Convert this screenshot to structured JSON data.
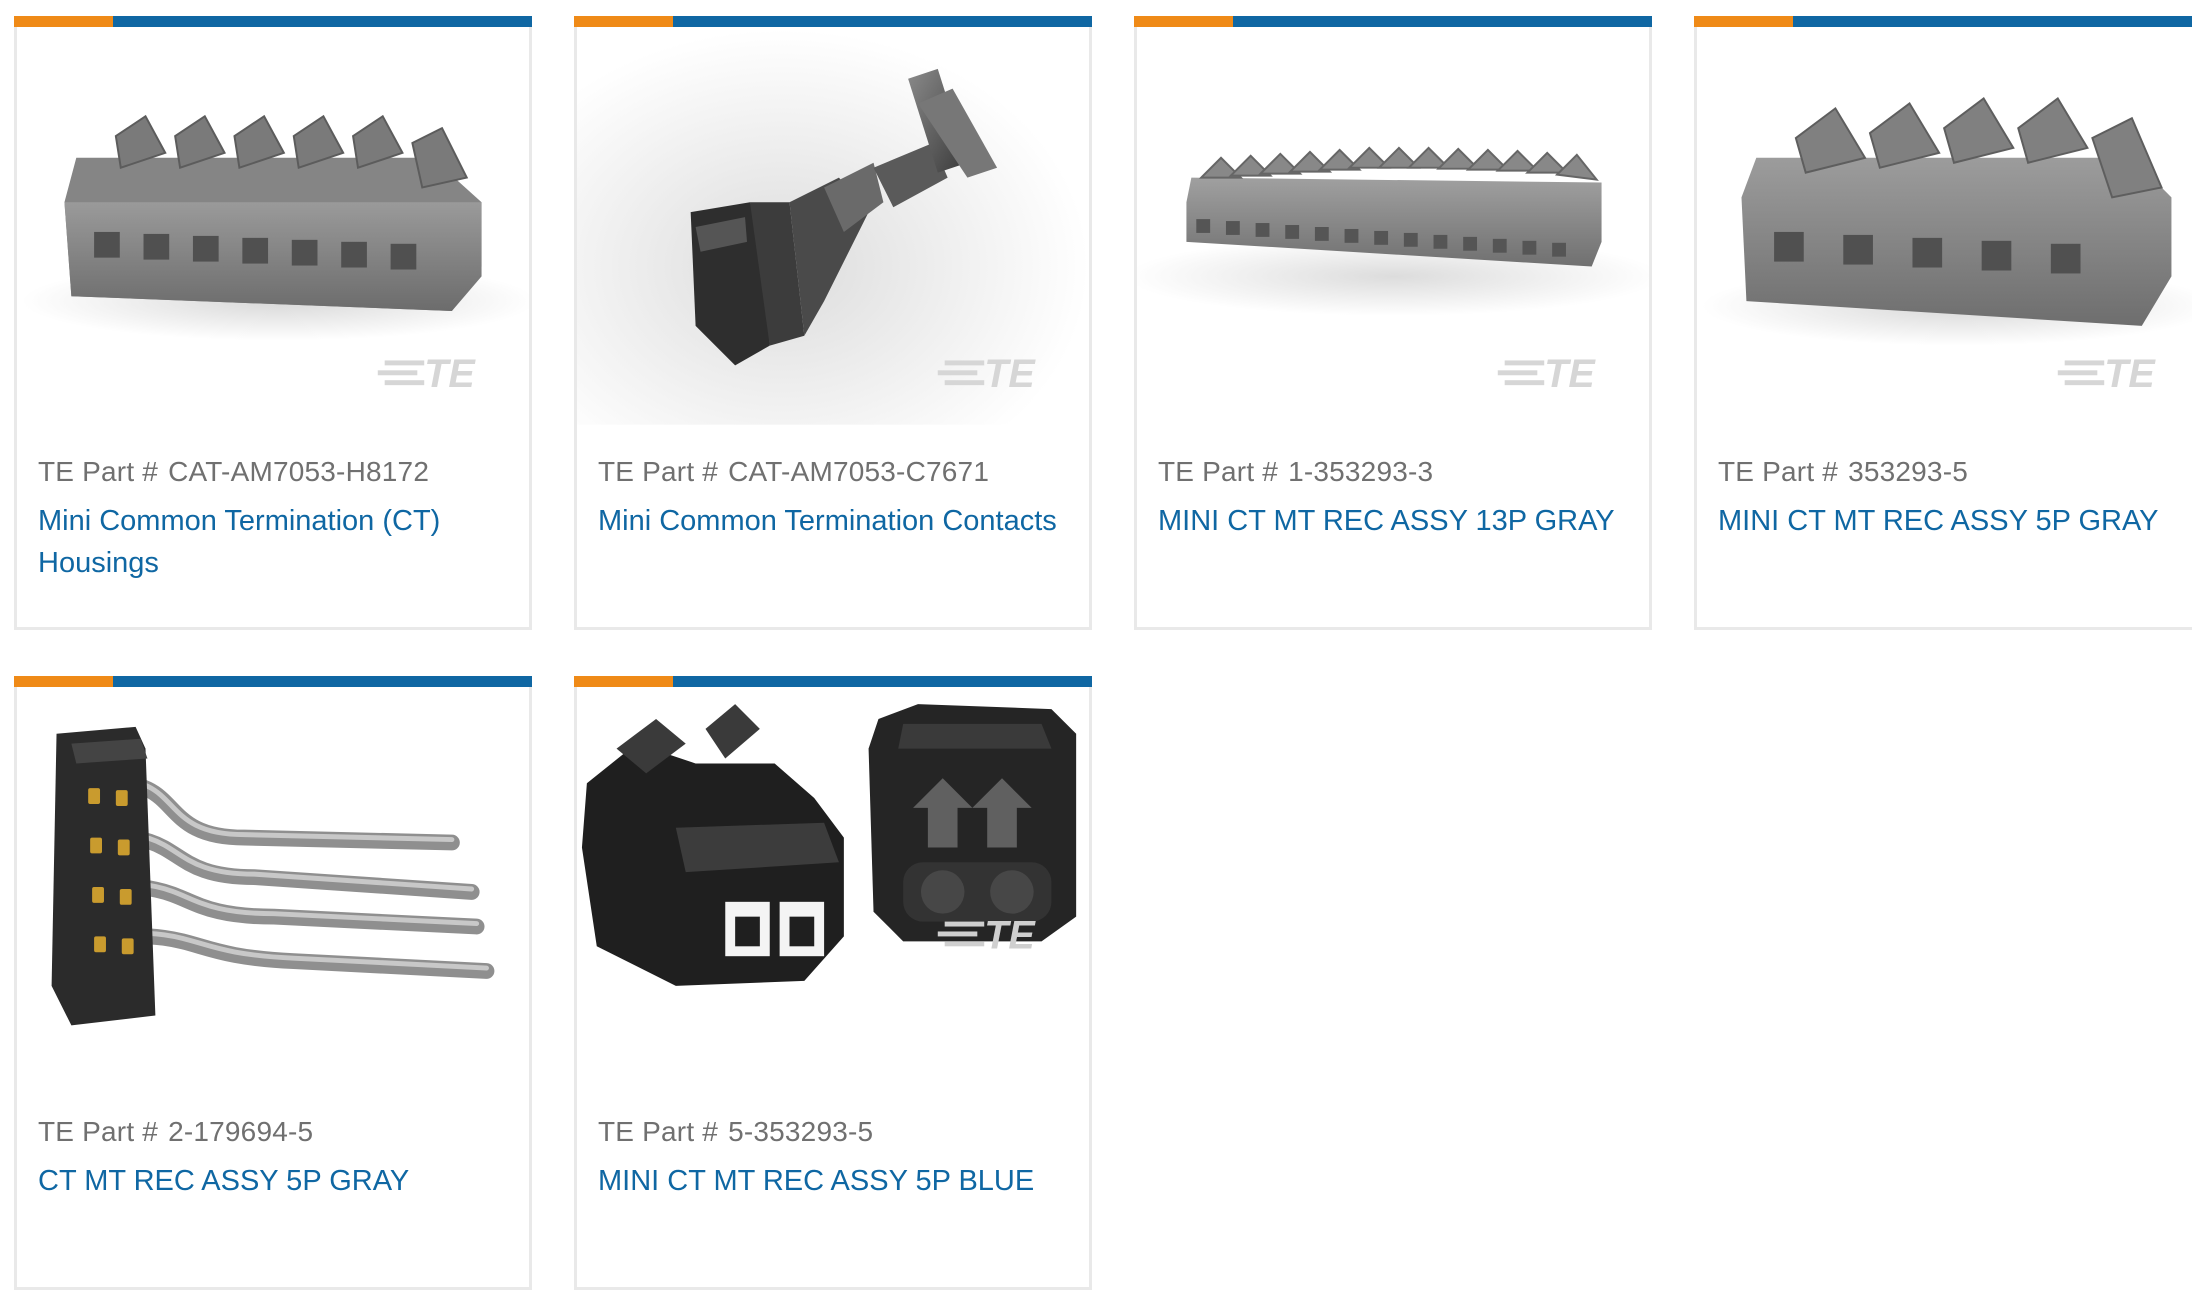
{
  "colors": {
    "accent_orange": "#ef8a17",
    "accent_blue": "#0f67a3",
    "part_text": "#707070",
    "border": "#e9e9e9"
  },
  "products": [
    {
      "part_label": "TE Part #",
      "part_number": "CAT-AM7053-H8172",
      "title": "Mini Common Termination (CT) Housings",
      "image": "housing-icon"
    },
    {
      "part_label": "TE Part #",
      "part_number": "CAT-AM7053-C7671",
      "title": "Mini Common Termination Contacts",
      "image": "contact-icon"
    },
    {
      "part_label": "TE Part #",
      "part_number": "1-353293-3",
      "title": "MINI CT MT REC ASSY 13P GRAY",
      "image": "housing-13p-icon"
    },
    {
      "part_label": "TE Part #",
      "part_number": "353293-5",
      "title": "MINI CT MT REC ASSY 5P GRAY",
      "image": "housing-5p-icon"
    },
    {
      "part_label": "TE Part #",
      "part_number": "2-179694-5",
      "title": "CT MT REC ASSY 5P GRAY",
      "image": "right-angle-header-icon"
    },
    {
      "part_label": "TE Part #",
      "part_number": "5-353293-5",
      "title": "MINI CT MT REC ASSY 5P BLUE",
      "image": "housing-blue-icon"
    }
  ],
  "watermark": "TE"
}
